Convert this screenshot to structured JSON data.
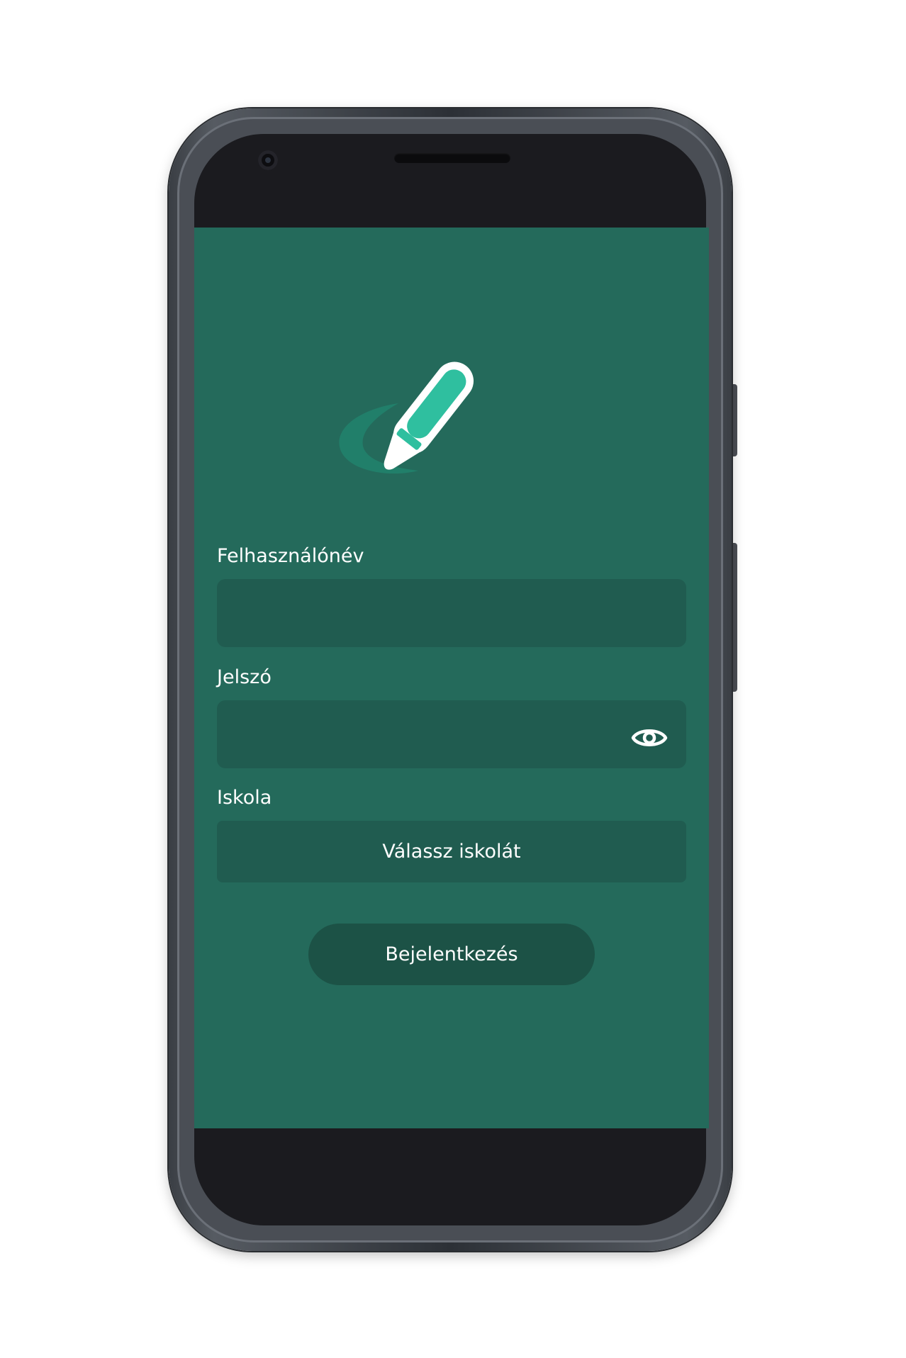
{
  "login": {
    "username_label": "Felhasználónév",
    "username_value": "",
    "password_label": "Jelszó",
    "password_value": "",
    "school_label": "Iskola",
    "school_select": "Válassz iskolát",
    "login_button": "Bejelentkezés"
  },
  "icons": {
    "logo": "pen-logo",
    "password_toggle": "eye-icon"
  },
  "colors": {
    "screen_background": "#246a5b",
    "field_background": "#205c50",
    "button_background": "#1c5246",
    "logo_accent": "#2fbf9f"
  }
}
